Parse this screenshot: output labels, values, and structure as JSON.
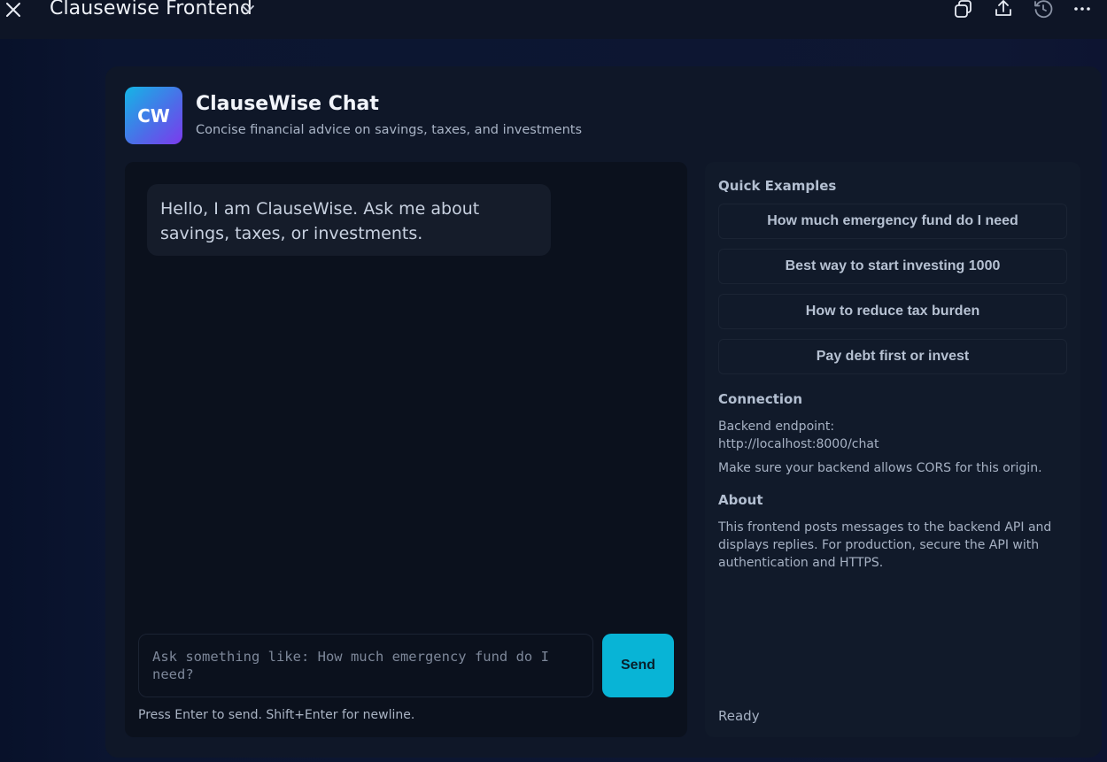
{
  "window": {
    "title": "Clausewise Frontend"
  },
  "header": {
    "logo_text": "CW",
    "title": "ClauseWise Chat",
    "subtitle": "Concise financial advice on savings, taxes, and investments"
  },
  "chat": {
    "messages": [
      {
        "role": "assistant",
        "text": "Hello, I am ClauseWise. Ask me about savings, taxes, or investments."
      }
    ],
    "input": {
      "value": "",
      "placeholder": "Ask something like: How much emergency fund do I need?"
    },
    "send_label": "Send",
    "hint": "Press Enter to send. Shift+Enter for newline."
  },
  "sidebar": {
    "quick_examples_title": "Quick Examples",
    "examples": [
      "How much emergency fund do I need",
      "Best way to start investing 1000",
      "How to reduce tax burden",
      "Pay debt first or invest"
    ],
    "connection_title": "Connection",
    "endpoint_label": "Backend endpoint:",
    "endpoint_url": "http://localhost:8000/chat",
    "cors_note": "Make sure your backend allows CORS for this origin.",
    "about_title": "About",
    "about_text": "This frontend posts messages to the backend API and displays replies. For production, secure the API with authentication and HTTPS.",
    "status": "Ready"
  },
  "icons": {
    "close": "close-icon",
    "chevron": "chevron-down-icon",
    "copy": "copy-icon",
    "share": "share-icon",
    "history": "history-icon",
    "more": "more-icon"
  },
  "colors": {
    "accent": "#08b4d6",
    "logo_gradient_start": "#14b6e6",
    "logo_gradient_end": "#7c3aed"
  }
}
